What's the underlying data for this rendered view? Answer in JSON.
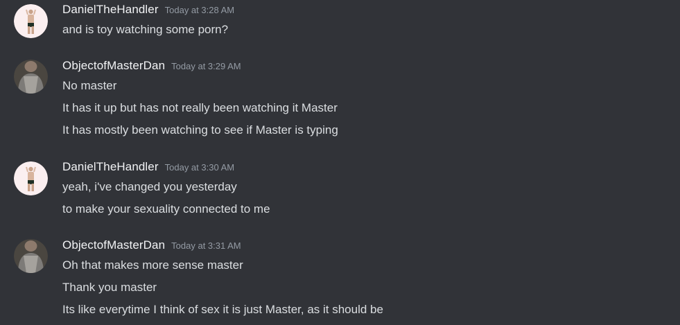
{
  "messages": [
    {
      "username": "DanielTheHandler",
      "timestamp": "Today at 3:28 AM",
      "avatar_icon": "figure-avatar-icon",
      "lines": [
        "and is toy watching some porn?"
      ]
    },
    {
      "username": "ObjectofMasterDan",
      "timestamp": "Today at 3:29 AM",
      "avatar_icon": "photo-avatar-icon",
      "lines": [
        "No master",
        "It has it up but has not really been watching it Master",
        "It has mostly been watching to see if Master is typing"
      ]
    },
    {
      "username": "DanielTheHandler",
      "timestamp": "Today at 3:30 AM",
      "avatar_icon": "figure-avatar-icon",
      "lines": [
        "yeah, i've changed you yesterday",
        "to make your sexuality connected to me"
      ]
    },
    {
      "username": "ObjectofMasterDan",
      "timestamp": "Today at 3:31 AM",
      "avatar_icon": "photo-avatar-icon",
      "lines": [
        "Oh that makes more sense master",
        "Thank you master",
        "Its like everytime I think of sex it is just Master, as it should be"
      ]
    }
  ],
  "colors": {
    "background": "#313338",
    "username": "#f2f3f5",
    "timestamp": "#949ba4",
    "message_text": "#dbdee1"
  }
}
